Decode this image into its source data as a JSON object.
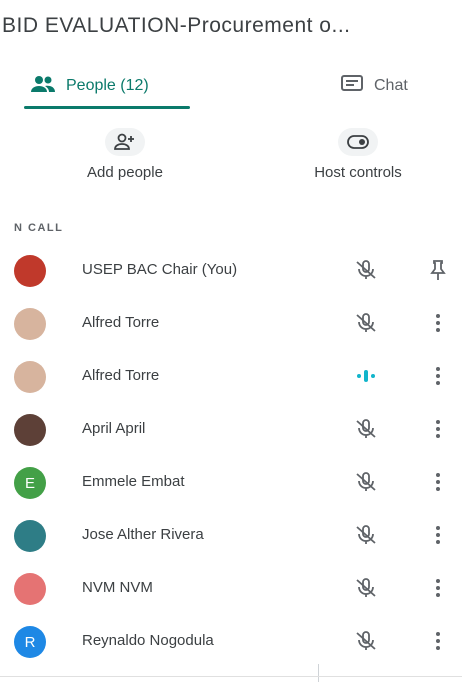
{
  "meeting": {
    "title": "BID EVALUATION-Procurement o..."
  },
  "tabs": [
    {
      "label": "People (12)",
      "icon": "people-icon"
    },
    {
      "label": "Chat",
      "icon": "chat-icon"
    }
  ],
  "actions": [
    {
      "label": "Add people",
      "icon": "add-person-icon"
    },
    {
      "label": "Host controls",
      "icon": "toggle-icon"
    }
  ],
  "section_label": "N CALL",
  "participants": [
    {
      "name": "USEP BAC Chair (You)",
      "avatar_color": "#c0392b",
      "avatar_letter": "",
      "mic": "muted",
      "action": "pin-icon"
    },
    {
      "name": "Alfred Torre",
      "avatar_color": "#d7b49e",
      "avatar_letter": "",
      "mic": "muted",
      "action": "more-vert-icon"
    },
    {
      "name": "Alfred Torre",
      "avatar_color": "#d7b49e",
      "avatar_letter": "",
      "mic": "speaking",
      "action": "more-vert-icon"
    },
    {
      "name": "April April",
      "avatar_color": "#5d4037",
      "avatar_letter": "",
      "mic": "muted",
      "action": "more-vert-icon"
    },
    {
      "name": "Emmele Embat",
      "avatar_color": "#43a047",
      "avatar_letter": "E",
      "mic": "muted",
      "action": "more-vert-icon"
    },
    {
      "name": "Jose Alther Rivera",
      "avatar_color": "#2e7d86",
      "avatar_letter": "",
      "mic": "muted",
      "action": "more-vert-icon"
    },
    {
      "name": "NVM NVM",
      "avatar_color": "#e57373",
      "avatar_letter": "",
      "mic": "muted",
      "action": "more-vert-icon"
    },
    {
      "name": "Reynaldo Nogodula",
      "avatar_color": "#1e88e5",
      "avatar_letter": "R",
      "mic": "muted",
      "action": "more-vert-icon"
    }
  ],
  "colors": {
    "accent": "#0b7a6b",
    "speaking": "#12b5cb"
  }
}
